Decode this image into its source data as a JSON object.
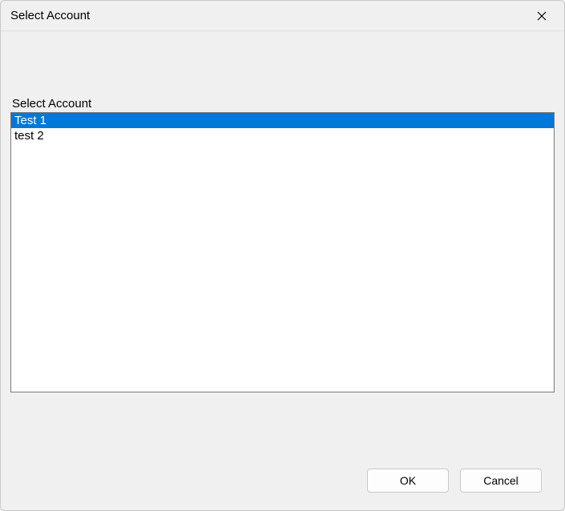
{
  "dialog": {
    "title": "Select Account",
    "label": "Select Account",
    "items": [
      {
        "label": "Test 1",
        "selected": true
      },
      {
        "label": "test 2",
        "selected": false
      }
    ],
    "buttons": {
      "ok": "OK",
      "cancel": "Cancel"
    }
  }
}
